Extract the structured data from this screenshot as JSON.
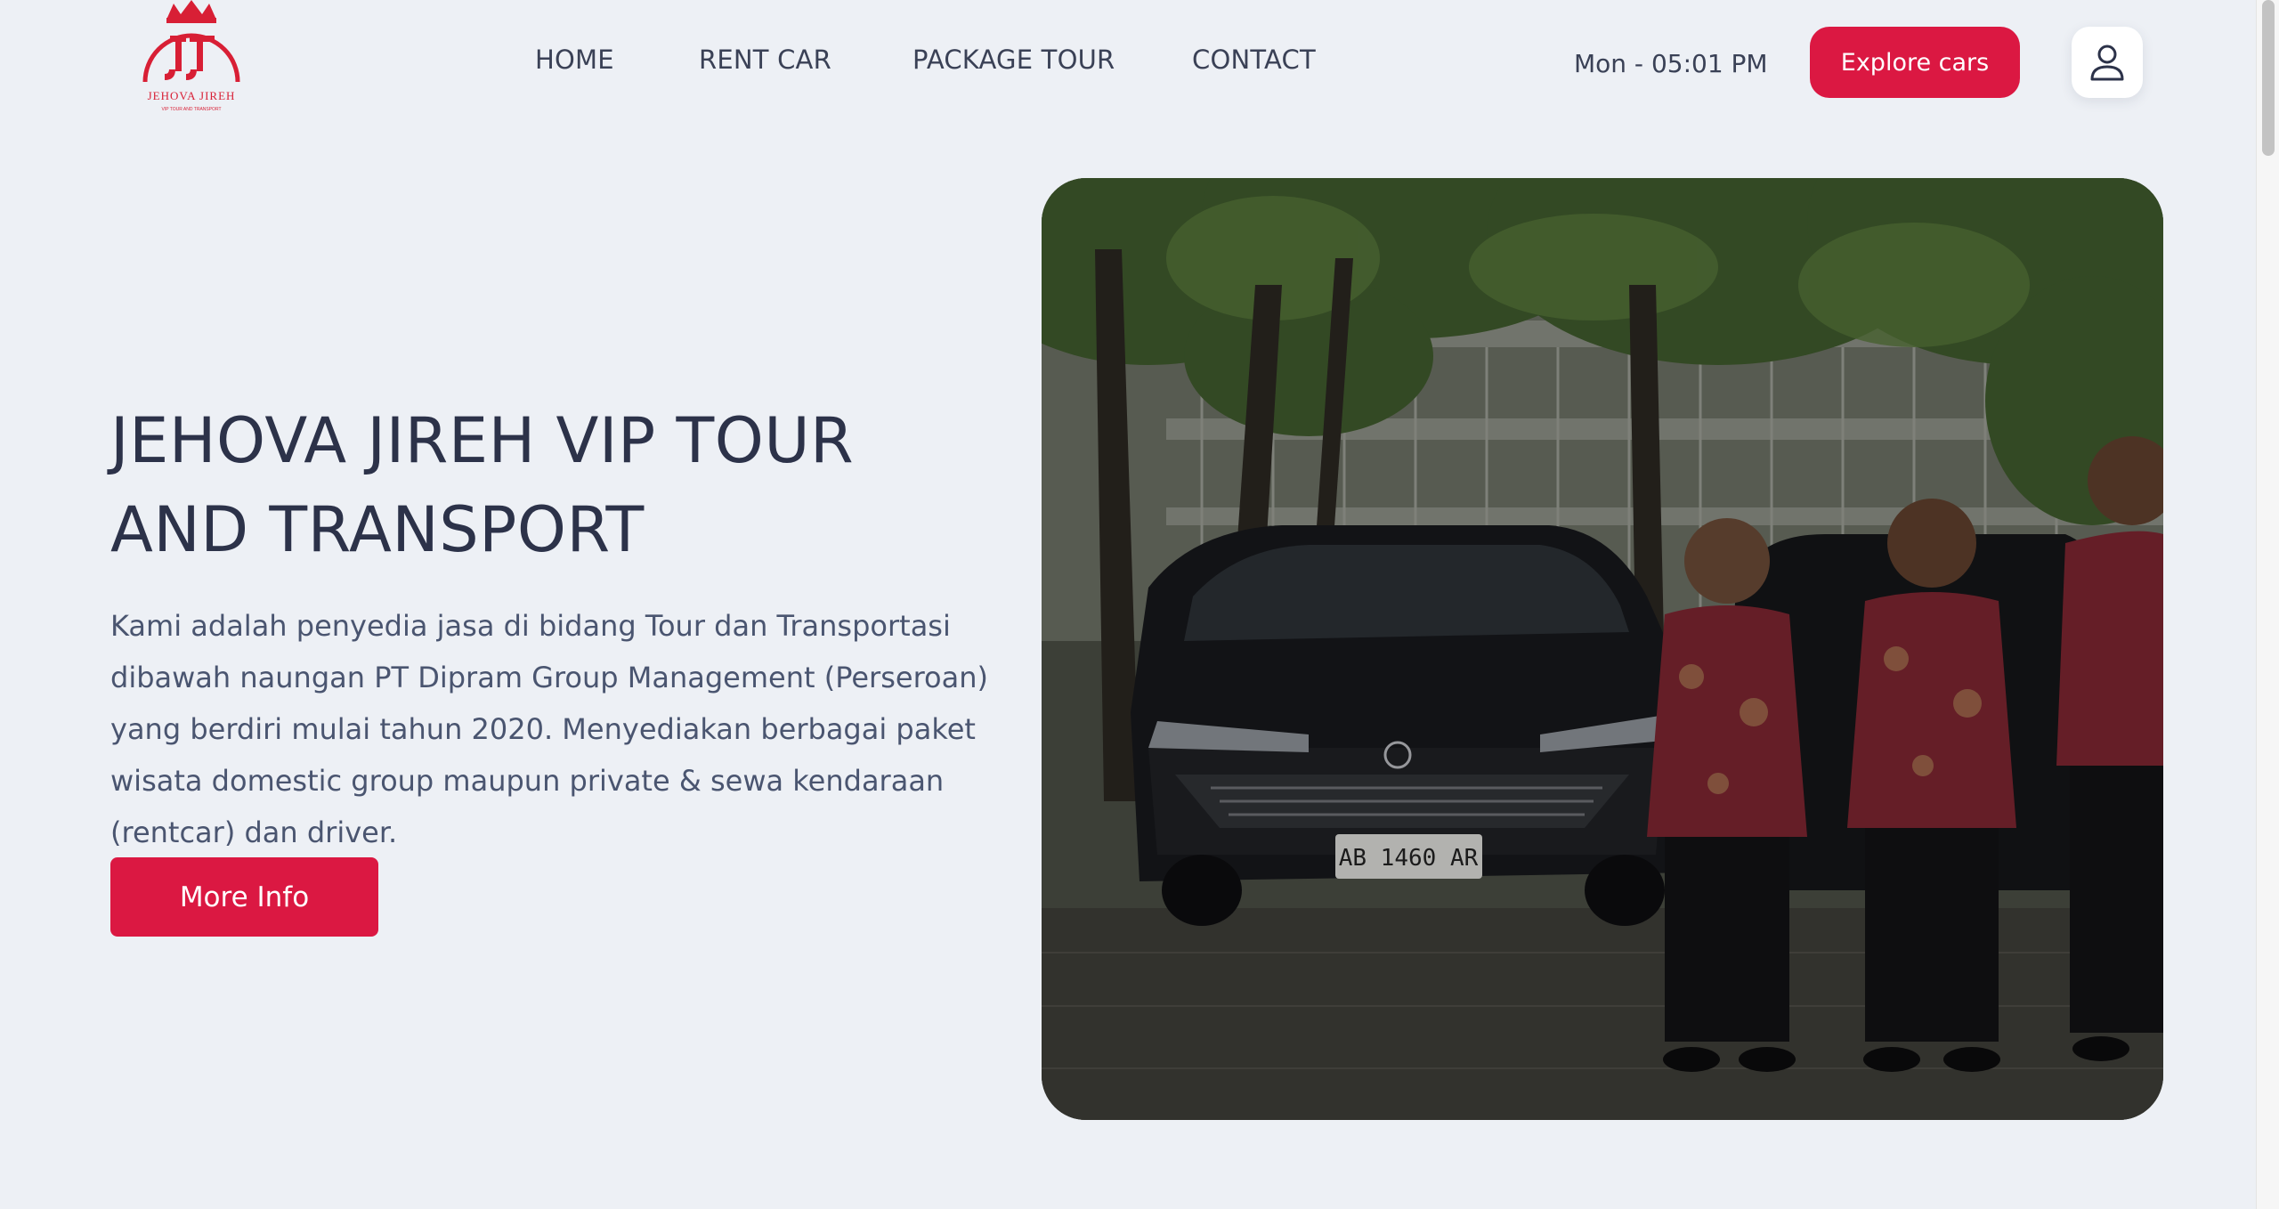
{
  "header": {
    "logo_text": "JEHOVA JIREH",
    "logo_tagline": "VIP TOUR AND TRANSPORT",
    "nav": [
      {
        "label": "HOME"
      },
      {
        "label": "RENT CAR"
      },
      {
        "label": "PACKAGE TOUR"
      },
      {
        "label": "CONTACT"
      }
    ],
    "clock": "Mon - 05:01 PM",
    "explore_label": "Explore cars",
    "user_icon": "user-icon"
  },
  "hero": {
    "title_line1": "JEHOVA JIREH VIP TOUR",
    "title_line2": "AND TRANSPORT",
    "description": "Kami adalah penyedia jasa di bidang Tour dan Transportasi dibawah naungan PT Dipram Group Management (Perseroan) yang berdiri mulai tahun 2020. Menyediakan berbagai paket wisata domestic group maupun private & sewa kendaraan (rentcar) dan driver.",
    "more_label": "More Info",
    "photo_plate": "AB 1460 AR"
  },
  "colors": {
    "accent": "#db1842",
    "background": "#edf0f5",
    "text": "#2c3249"
  }
}
